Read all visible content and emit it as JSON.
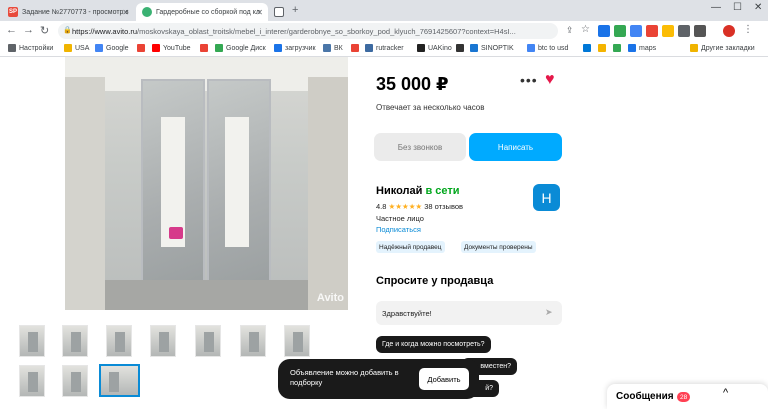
{
  "browser": {
    "tabs": [
      {
        "label": "Задание №2770773 - просмотр з",
        "favicon": "SP",
        "favicon_color": "#e84b3c",
        "active": false
      },
      {
        "label": "Гардеробные со сборкой под кл",
        "favicon": "avito",
        "favicon_color": "#3bb273",
        "active": true
      },
      {
        "label": "",
        "favicon": "page-icon",
        "favicon_color": "#5f6368",
        "active": false
      }
    ],
    "url_prefix": "https://www.avito.ru",
    "url_rest": "/moskovskaya_oblast_troitsk/mebel_i_interer/garderobnye_so_sborkoy_pod_klyuch_7691425607?context=H4sI...",
    "bookmarks": [
      {
        "label": "Настройки",
        "icon_color": "#5f6368"
      },
      {
        "label": "USA",
        "icon_color": "#f0b400"
      },
      {
        "label": "Google",
        "icon_color": "#4285f4"
      },
      {
        "label": "",
        "icon_color": "#ea4335"
      },
      {
        "label": "YouTube",
        "icon_color": "#ff0000"
      },
      {
        "label": "",
        "icon_color": "#ea4335"
      },
      {
        "label": "Google Диск",
        "icon_color": "#34a853"
      },
      {
        "label": "загрузчик",
        "icon_color": "#1a73e8"
      },
      {
        "label": "ВК",
        "icon_color": "#4a76a8"
      },
      {
        "label": "",
        "icon_color": "#ea4335"
      },
      {
        "label": "rutracker",
        "icon_color": "#3d6aa1"
      },
      {
        "label": "UAKino",
        "icon_color": "#222222"
      },
      {
        "label": "",
        "icon_color": "#333333"
      },
      {
        "label": "SINOPTIK",
        "icon_color": "#1976d2"
      },
      {
        "label": "btc to usd",
        "icon_color": "#4285f4"
      },
      {
        "label": "",
        "icon_color": "#0078d7"
      },
      {
        "label": "",
        "icon_color": "#f4b400"
      },
      {
        "label": "",
        "icon_color": "#34a853"
      },
      {
        "label": "maps",
        "icon_color": "#1a73e8"
      },
      {
        "label": "Другие закладки",
        "icon_color": "#f0b400"
      }
    ]
  },
  "listing": {
    "photo_watermark": "Avito",
    "price": "35 000 ₽",
    "replies": "Отвечает за несколько часов",
    "btn_calls": "Без звонков",
    "btn_write": "Написать",
    "seller_name": "Николай",
    "seller_status": "в сети",
    "rating_value": "4.8",
    "rating_stars": "★★★★★",
    "reviews": "38 отзывов",
    "person_type": "Частное лицо",
    "subscribe": "Подписаться",
    "avatar_letter": "Н",
    "badges": [
      "Надёжный продавец",
      "Документы проверены"
    ],
    "ask_title": "Спросите у продавца",
    "message_value": "Здравствуйте!",
    "chips": [
      "Где и когда можно посмотреть?",
      "вместен?",
      "й?"
    ],
    "toast_text": "Объявление можно добавить в подборку",
    "toast_button": "Добавить",
    "messages_label": "Сообщения",
    "messages_count": "28"
  },
  "colors": {
    "accent": "#00aaff",
    "online": "#02a71d",
    "heart": "#e5184a",
    "link": "#0a8bd6"
  }
}
